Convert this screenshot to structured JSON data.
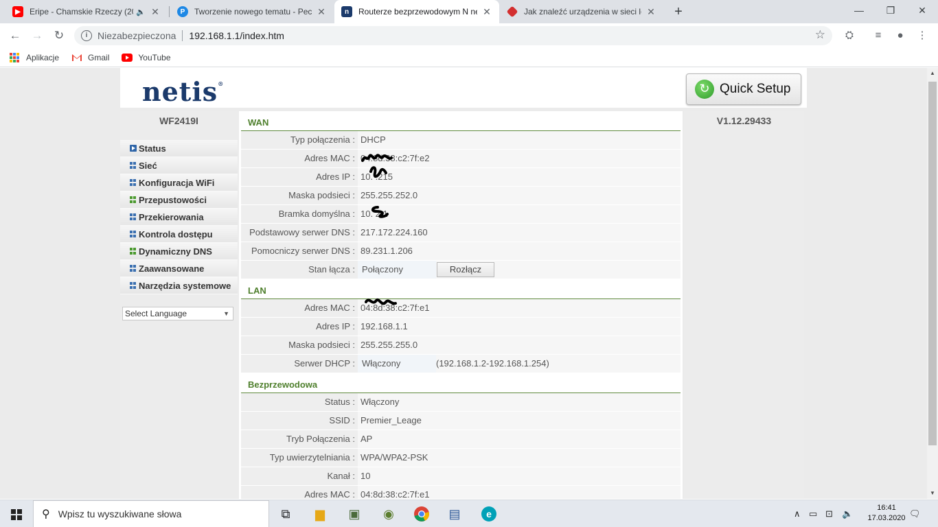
{
  "browser": {
    "tabs": [
      {
        "title": "Eripe - Chamskie Rzeczy (201",
        "favicon": "youtube-icon",
        "color": "#ff0000",
        "active": false
      },
      {
        "title": "Tworzenie nowego tematu - Pece",
        "favicon": "pecetowiec-icon",
        "color": "#1e88e5",
        "active": false
      },
      {
        "title": "Routerze bezprzewodowym N ne",
        "favicon": "netis-icon",
        "color": "#1b3a6b",
        "active": true
      },
      {
        "title": "Jak znaleźć urządzenia w sieci lok",
        "favicon": "diamond-icon",
        "color": "#d32f2f",
        "active": false
      }
    ],
    "new_tab": "+",
    "address": {
      "security": "Niezabezpieczona",
      "url": "192.168.1.1/index.htm"
    },
    "bookmarks": [
      {
        "label": "Aplikacje",
        "icon": "apps-grid-icon"
      },
      {
        "label": "Gmail",
        "icon": "gmail-icon"
      },
      {
        "label": "YouTube",
        "icon": "youtube-icon"
      }
    ]
  },
  "router": {
    "quick_setup": "Quick Setup",
    "model": "WF2419I",
    "version": "V1.12.29433",
    "menu": [
      {
        "label": "Status",
        "icon": "arrow"
      },
      {
        "label": "Sieć",
        "icon": "grid"
      },
      {
        "label": "Konfiguracja WiFi",
        "icon": "grid"
      },
      {
        "label": "Przepustowości",
        "icon": "plus"
      },
      {
        "label": "Przekierowania",
        "icon": "grid"
      },
      {
        "label": "Kontrola dostępu",
        "icon": "grid"
      },
      {
        "label": "Dynamiczny DNS",
        "icon": "plus"
      },
      {
        "label": "Zaawansowane",
        "icon": "grid"
      },
      {
        "label": "Narzędzia systemowe",
        "icon": "grid"
      }
    ],
    "language": "Select Language",
    "wan": {
      "title": "WAN",
      "rows": [
        {
          "label": "Typ połączenia :",
          "value": "DHCP"
        },
        {
          "label": "Adres MAC :",
          "value": "04:8d:38:c2:7f:e2"
        },
        {
          "label": "Adres IP :",
          "value": "10.      .215"
        },
        {
          "label": "Maska podsieci :",
          "value": "255.255.252.0"
        },
        {
          "label": "Bramka domyślna :",
          "value": "10.       2.1"
        },
        {
          "label": "Podstawowy serwer DNS :",
          "value": "217.172.224.160"
        },
        {
          "label": "Pomocniczy serwer DNS :",
          "value": "89.231.1.206"
        }
      ],
      "link": {
        "label": "Stan łącza :",
        "value": "Połączony",
        "button": "Rozłącz"
      }
    },
    "lan": {
      "title": "LAN",
      "rows": [
        {
          "label": "Adres MAC :",
          "value": "04:8d:38:c2:7f:e1"
        },
        {
          "label": "Adres IP :",
          "value": "192.168.1.1"
        },
        {
          "label": "Maska podsieci :",
          "value": "255.255.255.0"
        }
      ],
      "dhcp": {
        "label": "Serwer DHCP :",
        "value": "Włączony",
        "range": "(192.168.1.2-192.168.1.254)"
      }
    },
    "wireless": {
      "title": "Bezprzewodowa",
      "rows": [
        {
          "label": "Status :",
          "value": "Włączony"
        },
        {
          "label": "SSID :",
          "value": "Premier_Leage"
        },
        {
          "label": "Tryb Połączenia :",
          "value": "AP"
        },
        {
          "label": "Typ uwierzytelniania :",
          "value": "WPA/WPA2-PSK"
        },
        {
          "label": "Kanał :",
          "value": "10"
        },
        {
          "label": "Adres MAC :",
          "value": "04:8d:38:c2:7f:e1"
        }
      ]
    }
  },
  "taskbar": {
    "search_placeholder": "Wpisz tu wyszukiwane słowa",
    "time": "16:41",
    "date": "17.03.2020"
  }
}
